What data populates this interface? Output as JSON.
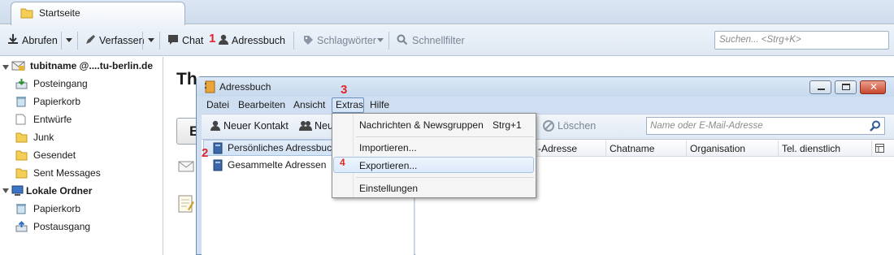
{
  "tabs": [
    {
      "label": "Startseite"
    }
  ],
  "toolbar": {
    "get_messages": "Abrufen",
    "write": "Verfassen",
    "chat": "Chat",
    "step_1": "1",
    "address_book": "Adressbuch",
    "tags": "Schlagwörter",
    "quick_filter": "Schnellfilter",
    "search_placeholder": "Suchen... <Strg+K>"
  },
  "folders": {
    "account": "tubitname @....tu-berlin.de",
    "inbox": "Posteingang",
    "trash": "Papierkorb",
    "drafts": "Entwürfe",
    "junk": "Junk",
    "sent": "Gesendet",
    "sent_messages": "Sent Messages",
    "local_folders": "Lokale Ordner",
    "local_trash": "Papierkorb",
    "outbox": "Postausgang"
  },
  "main": {
    "heading_start": "Th",
    "button_start": "E"
  },
  "addressbook": {
    "title": "Adressbuch",
    "menus": {
      "file": "Datei",
      "edit": "Bearbeiten",
      "view": "Ansicht",
      "tools": "Extras",
      "help": "Hilfe"
    },
    "step_3": "3",
    "toolbar": {
      "new_contact": "Neuer Kontakt",
      "new_list_partial": "Neu",
      "delete": "Löschen",
      "search_placeholder": "Name oder E-Mail-Adresse"
    },
    "directories": {
      "step_2": "2",
      "personal": "Persönliches Adressbuch",
      "collected": "Gesammelte Adressen"
    },
    "columns": {
      "email": "-Adresse",
      "chat_name": "Chatname",
      "organization": "Organisation",
      "work_phone": "Tel. dienstlich"
    }
  },
  "extras_menu": {
    "news_groups": "Nachrichten & Newsgruppen",
    "news_groups_shortcut": "Strg+1",
    "import": "Importieren...",
    "step_4": "4",
    "export": "Exportieren...",
    "settings": "Einstellungen"
  },
  "colors": {
    "step_marker": "#e1262b",
    "window_frame": "#cfdff1",
    "highlight": "#dceafb"
  }
}
